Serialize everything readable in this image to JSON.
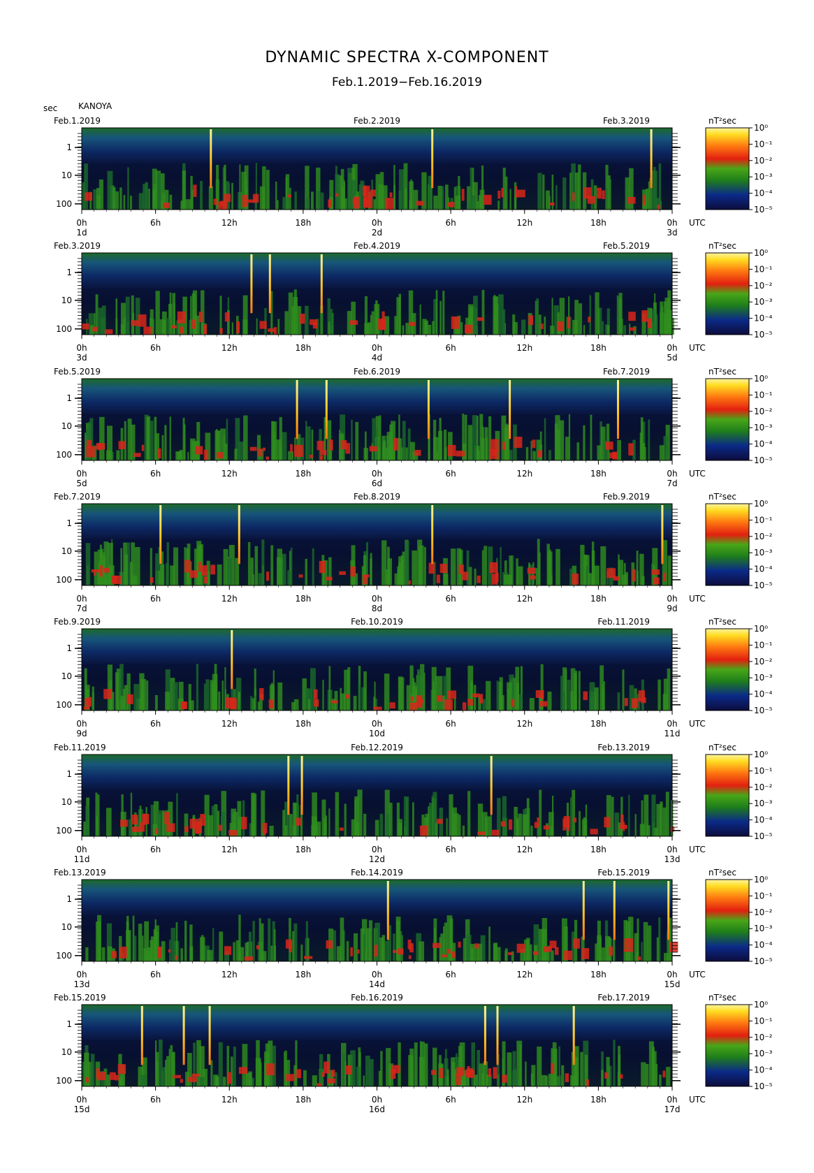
{
  "header": {
    "title": "DYNAMIC SPECTRA X-COMPONENT",
    "subtitle": "Feb.1.2019−Feb.16.2019",
    "period_unit": "sec",
    "station": "KANOYA"
  },
  "chart_data": {
    "type": "heatmap",
    "title": "DYNAMIC SPECTRA X-COMPONENT",
    "subtitle": "Feb.1.2019−Feb.16.2019",
    "ylabel": "sec",
    "yticks": [
      "1",
      "10",
      "100"
    ],
    "yscale": "log",
    "xticks": [
      "0h",
      "6h",
      "12h",
      "18h",
      "0h",
      "6h",
      "12h",
      "18h",
      "0h"
    ],
    "x_unit": "UTC",
    "colorbar_unit": "nT²sec",
    "colorbar_ticks": [
      "10⁰",
      "10⁻¹",
      "10⁻²",
      "10⁻³",
      "10⁻⁴",
      "10⁻⁵"
    ],
    "colormap": [
      "#0c0c3c",
      "#0b2a88",
      "#1f7f1a",
      "#49a618",
      "#e22010",
      "#ff7a10",
      "#ffdd22",
      "#fff4a0"
    ],
    "panels": [
      {
        "left_date": "Feb.1.2019",
        "mid_date": "Feb.2.2019",
        "right_date": "Feb.3.2019",
        "day_labels": [
          "1d",
          "2d",
          "3d"
        ]
      },
      {
        "left_date": "Feb.3.2019",
        "mid_date": "Feb.4.2019",
        "right_date": "Feb.5.2019",
        "day_labels": [
          "3d",
          "4d",
          "5d"
        ]
      },
      {
        "left_date": "Feb.5.2019",
        "mid_date": "Feb.6.2019",
        "right_date": "Feb.7.2019",
        "day_labels": [
          "5d",
          "6d",
          "7d"
        ]
      },
      {
        "left_date": "Feb.7.2019",
        "mid_date": "Feb.8.2019",
        "right_date": "Feb.9.2019",
        "day_labels": [
          "7d",
          "8d",
          "9d"
        ]
      },
      {
        "left_date": "Feb.9.2019",
        "mid_date": "Feb.10.2019",
        "right_date": "Feb.11.2019",
        "day_labels": [
          "9d",
          "10d",
          "11d"
        ]
      },
      {
        "left_date": "Feb.11.2019",
        "mid_date": "Feb.12.2019",
        "right_date": "Feb.13.2019",
        "day_labels": [
          "11d",
          "12d",
          "13d"
        ]
      },
      {
        "left_date": "Feb.13.2019",
        "mid_date": "Feb.14.2019",
        "right_date": "Feb.15.2019",
        "day_labels": [
          "13d",
          "14d",
          "15d"
        ]
      },
      {
        "left_date": "Feb.15.2019",
        "mid_date": "Feb.16.2019",
        "right_date": "Feb.17.2019",
        "day_labels": [
          "15d",
          "16d",
          "17d"
        ]
      }
    ],
    "spikes_hours": [
      [
        10.5,
        28.5,
        46.3
      ],
      [
        13.8,
        15.3,
        19.5
      ],
      [
        17.5,
        19.9,
        28.2,
        34.8,
        43.6
      ],
      [
        6.4,
        12.8,
        28.5,
        47.2
      ],
      [
        12.2
      ],
      [
        16.8,
        17.9,
        33.3
      ],
      [
        24.9,
        40.8,
        43.3,
        47.7
      ],
      [
        4.9,
        8.3,
        10.4,
        32.8,
        33.8,
        40.0
      ]
    ]
  }
}
